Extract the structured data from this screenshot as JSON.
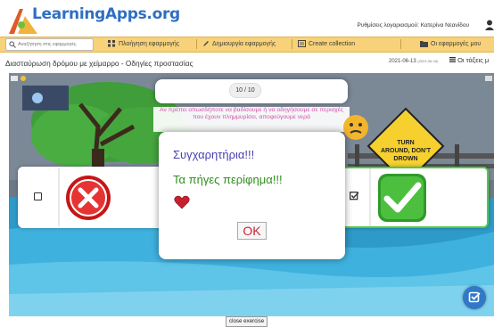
{
  "header": {
    "logo": "LearningApps.org",
    "account_label": "Ρυθμίσεις λογαριασμού: Κατερίνα Νεανίδου"
  },
  "nav": {
    "search_placeholder": "Αναζήτηση στις εφαρμογές",
    "browse": "Πλοήγηση εφαρμογής",
    "create": "Δημιουργία εφαρμογής",
    "collection": "Create collection",
    "my_apps": "Οι εφαρμογές μου"
  },
  "page": {
    "title": "Διασταύρωση δρόμου με χείμαρρο - Οδηγίες προστασίας",
    "date": "2021-06-13",
    "date_small": "(2021-06-16)",
    "classes": "Οι τάξεις μ"
  },
  "game": {
    "counter": "10 / 10",
    "question": "Αν πρέπει οπωσδήποτε να βαδίσουμε ή να οδηγήσουμε σε περιοχές που έχουν πλημμυρίσει, αποφεύγουμε νερά",
    "sign_line1": "TURN",
    "sign_line2": "AROUND, DON'T",
    "sign_line3": "DROWN",
    "dialog_title": "Συγχαρητήρια!!!",
    "dialog_praise": "Τα πήγες περίφημα!!!",
    "ok": "OK",
    "close_exercise": "close exercise"
  },
  "colors": {
    "accent_bar": "#f7d27a",
    "correct": "#2f9a2a",
    "wrong": "#d21f1f",
    "pink_text": "#d44fae"
  }
}
